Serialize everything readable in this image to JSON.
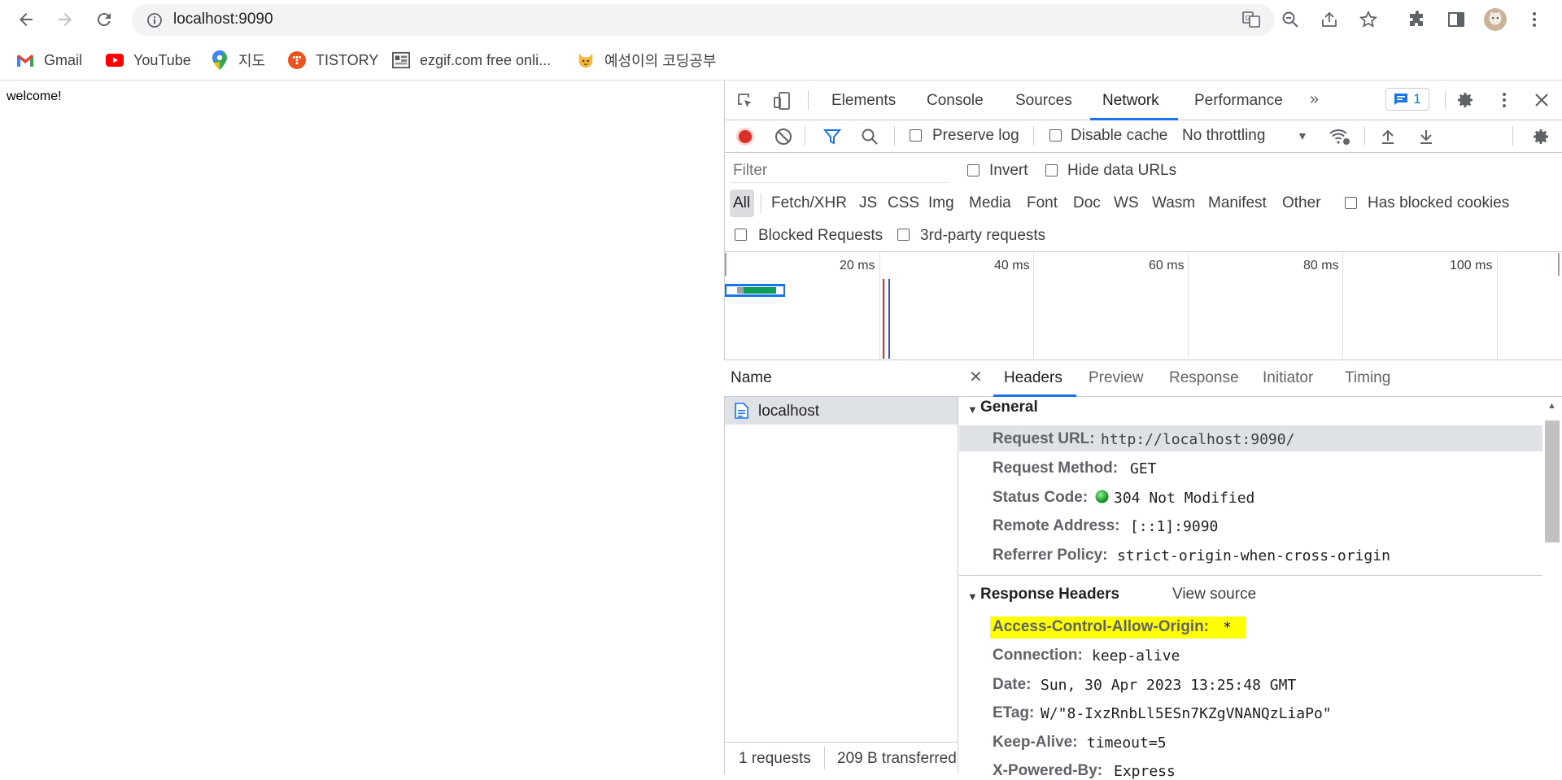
{
  "browser": {
    "url": "localhost:9090",
    "bookmarks": [
      {
        "label": "Gmail",
        "icon": "gmail-icon"
      },
      {
        "label": "YouTube",
        "icon": "youtube-icon"
      },
      {
        "label": "지도",
        "icon": "maps-pin-icon"
      },
      {
        "label": "TISTORY",
        "icon": "tistory-icon"
      },
      {
        "label": "ezgif.com free onli...",
        "icon": "ezgif-icon"
      },
      {
        "label": "예성이의 코딩공부",
        "icon": "cat-icon"
      }
    ]
  },
  "page": {
    "text": "welcome!"
  },
  "devtools": {
    "tabs": [
      "Elements",
      "Console",
      "Sources",
      "Network",
      "Performance"
    ],
    "active_tab": "Network",
    "issues_count": "1",
    "toolbar": {
      "preserve_log": "Preserve log",
      "disable_cache": "Disable cache",
      "throttling": "No throttling"
    },
    "filter": {
      "placeholder": "Filter",
      "invert": "Invert",
      "hide_data_urls": "Hide data URLs",
      "types": [
        "All",
        "Fetch/XHR",
        "JS",
        "CSS",
        "Img",
        "Media",
        "Font",
        "Doc",
        "WS",
        "Wasm",
        "Manifest",
        "Other"
      ],
      "has_blocked_cookies": "Has blocked cookies",
      "blocked_requests": "Blocked Requests",
      "third_party": "3rd-party requests"
    },
    "overview_ticks": [
      "20 ms",
      "40 ms",
      "60 ms",
      "80 ms",
      "100 ms"
    ],
    "requests": {
      "column_name": "Name",
      "rows": [
        "localhost"
      ],
      "summary_count": "1 requests",
      "summary_transferred": "209 B transferred"
    },
    "detail_tabs": [
      "Headers",
      "Preview",
      "Response",
      "Initiator",
      "Timing"
    ],
    "general": {
      "title": "General",
      "request_url_key": "Request URL:",
      "request_url": "http://localhost:9090/",
      "method_key": "Request Method:",
      "method": "GET",
      "status_key": "Status Code:",
      "status": "304 Not Modified",
      "status_color": "#1e8e3e",
      "remote_key": "Remote Address:",
      "remote": "[::1]:9090",
      "referrer_key": "Referrer Policy:",
      "referrer": "strict-origin-when-cross-origin"
    },
    "response_headers": {
      "title": "Response Headers",
      "view_source": "View source",
      "items": [
        {
          "key": "Access-Control-Allow-Origin:",
          "value": "*"
        },
        {
          "key": "Connection:",
          "value": "keep-alive"
        },
        {
          "key": "Date:",
          "value": "Sun, 30 Apr 2023 13:25:48 GMT"
        },
        {
          "key": "ETag:",
          "value": "W/\"8-IxzRnbLl5ESn7KZgVNANQzLiaPo\""
        },
        {
          "key": "Keep-Alive:",
          "value": "timeout=5"
        },
        {
          "key": "X-Powered-By:",
          "value": "Express"
        }
      ],
      "highlight_color": "#ffff00"
    },
    "accent_color": "#1a73e8"
  }
}
